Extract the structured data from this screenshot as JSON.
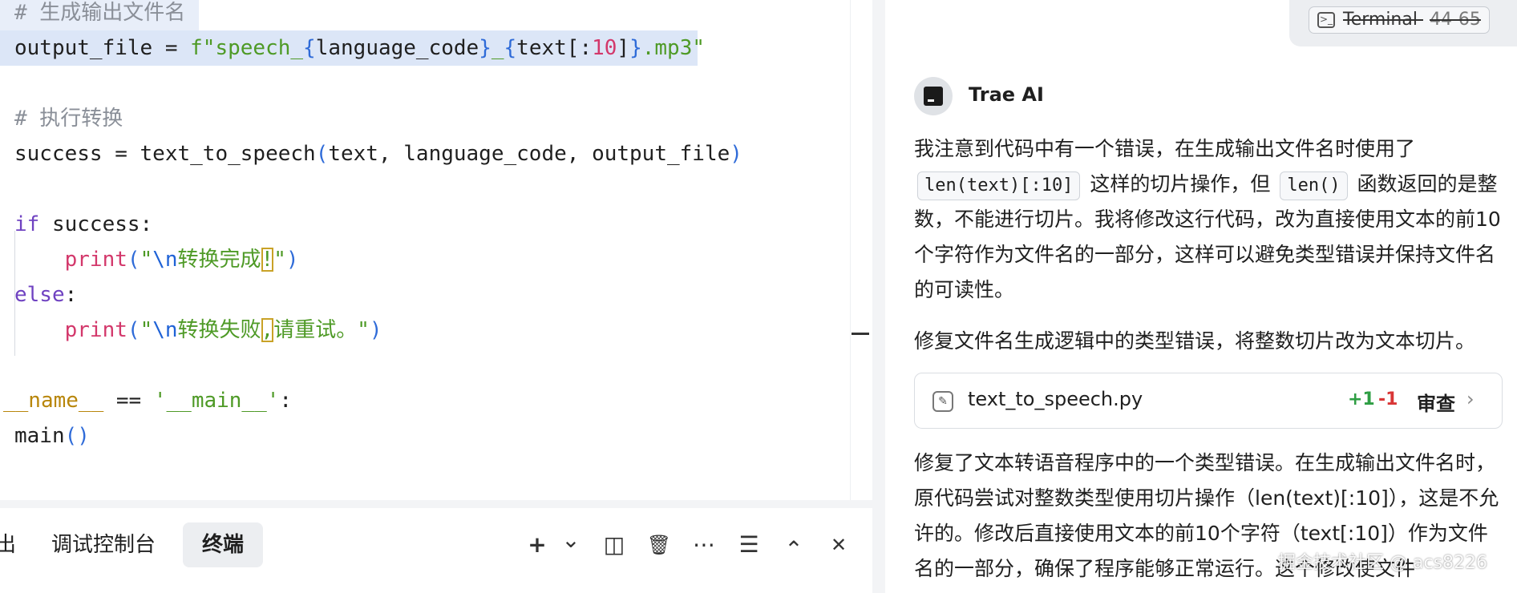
{
  "editor": {
    "lines": [
      {
        "id": "l1",
        "segments": [
          {
            "t": "# 生成输出文件名",
            "c": "c-comment"
          }
        ]
      },
      {
        "id": "l2",
        "segments": [
          {
            "t": "output_file",
            "c": "c-op"
          },
          {
            "t": " = ",
            "c": "c-op"
          },
          {
            "t": "f\"speech_",
            "c": "c-str"
          },
          {
            "t": "{",
            "c": "c-paren"
          },
          {
            "t": "language_code",
            "c": "c-op"
          },
          {
            "t": "}",
            "c": "c-paren"
          },
          {
            "t": "_",
            "c": "c-str"
          },
          {
            "t": "{",
            "c": "c-paren"
          },
          {
            "t": "text",
            "c": "c-op"
          },
          {
            "t": "[:",
            "c": "c-op"
          },
          {
            "t": "10",
            "c": "c-num"
          },
          {
            "t": "]",
            "c": "c-op"
          },
          {
            "t": "}",
            "c": "c-paren"
          },
          {
            "t": ".mp3\"",
            "c": "c-str"
          }
        ]
      },
      {
        "id": "l3",
        "segments": []
      },
      {
        "id": "l4",
        "segments": [
          {
            "t": "# 执行转换",
            "c": "c-comment"
          }
        ]
      },
      {
        "id": "l5",
        "segments": [
          {
            "t": "success = text_to_speech",
            "c": "c-op"
          },
          {
            "t": "(",
            "c": "c-paren"
          },
          {
            "t": "text, language_code, output_file",
            "c": "c-op"
          },
          {
            "t": ")",
            "c": "c-paren"
          }
        ]
      },
      {
        "id": "l6",
        "segments": []
      },
      {
        "id": "l7",
        "segments": [
          {
            "t": "if",
            "c": "c-kw"
          },
          {
            "t": " success:",
            "c": "c-op"
          }
        ]
      },
      {
        "id": "l8",
        "segments": [
          {
            "t": "    "
          },
          {
            "t": "print",
            "c": "c-fn"
          },
          {
            "t": "(",
            "c": "c-paren"
          },
          {
            "t": "\"",
            "c": "c-str"
          },
          {
            "t": "\\n",
            "c": "c-esc"
          },
          {
            "t": "转换完成",
            "c": "c-str"
          },
          {
            "t": "!",
            "c": "c-str boxmark"
          },
          {
            "t": "\"",
            "c": "c-str"
          },
          {
            "t": ")",
            "c": "c-paren"
          }
        ]
      },
      {
        "id": "l9",
        "segments": [
          {
            "t": "else",
            "c": "c-kw"
          },
          {
            "t": ":",
            "c": "c-op"
          }
        ]
      },
      {
        "id": "l10",
        "segments": [
          {
            "t": "    "
          },
          {
            "t": "print",
            "c": "c-fn"
          },
          {
            "t": "(",
            "c": "c-paren"
          },
          {
            "t": "\"",
            "c": "c-str"
          },
          {
            "t": "\\n",
            "c": "c-esc"
          },
          {
            "t": "转换失败",
            "c": "c-str"
          },
          {
            "t": ",",
            "c": "c-str boxmark"
          },
          {
            "t": "请重试。\"",
            "c": "c-str"
          },
          {
            "t": ")",
            "c": "c-paren"
          }
        ]
      },
      {
        "id": "l11",
        "segments": []
      },
      {
        "id": "l12",
        "segments": [
          {
            "t": "__name__",
            "c": "c-dunder"
          },
          {
            "t": " == ",
            "c": "c-op"
          },
          {
            "t": "'__main__'",
            "c": "c-str"
          },
          {
            "t": ":",
            "c": "c-op"
          }
        ]
      },
      {
        "id": "l13",
        "segments": [
          {
            "t": "main",
            "c": "c-op"
          },
          {
            "t": "()",
            "c": "c-paren"
          }
        ]
      }
    ]
  },
  "bottom_panel": {
    "tabs": [
      {
        "label": "出",
        "active": false
      },
      {
        "label": "调试控制台",
        "active": false
      },
      {
        "label": "终端",
        "active": true
      }
    ],
    "tools": [
      {
        "name": "plus-icon",
        "glyph": "+"
      },
      {
        "name": "chevron-down-icon",
        "glyph": "⌄"
      },
      {
        "name": "split-panel-icon",
        "glyph": "◫"
      },
      {
        "name": "trash-icon",
        "glyph": "🗑"
      },
      {
        "name": "more-icon",
        "glyph": "⋯"
      },
      {
        "name": "settings-sliders-icon",
        "glyph": "☰"
      },
      {
        "name": "chevron-up-icon",
        "glyph": "⌃"
      },
      {
        "name": "close-icon",
        "glyph": "✕"
      }
    ]
  },
  "ai_panel": {
    "terminal_chip": {
      "label": "Terminal",
      "range": "44-65"
    },
    "assistant_name": "Trae AI",
    "para1": {
      "before": "我注意到代码中有一个错误，在生成输出文件名时使用了",
      "code1": "len(text)[:10]",
      "middle": "这样的切片操作，但",
      "code2": "len()",
      "after": "函数返回的是整数，不能进行切片。我将修改这行代码，改为直接使用文本的前10个字符作为文件名的一部分，这样可以避免类型错误并保持文件名的可读性。"
    },
    "para2": "修复文件名生成逻辑中的类型错误，将整数切片改为文本切片。",
    "file_card": {
      "file_name": "text_to_speech.py",
      "additions": "+1",
      "deletions": "-1",
      "review_label": "审查"
    },
    "para3": "修复了文本转语音程序中的一个类型错误。在生成输出文件名时，原代码尝试对整数类型使用切片操作（len(text)[:10]），这是不允许的。修改后直接使用文本的前10个字符（text[:10]）作为文件名的一部分，确保了程序能够正常运行。这个修改使文件",
    "watermark": "掘金技术社区 @ acs8226"
  }
}
